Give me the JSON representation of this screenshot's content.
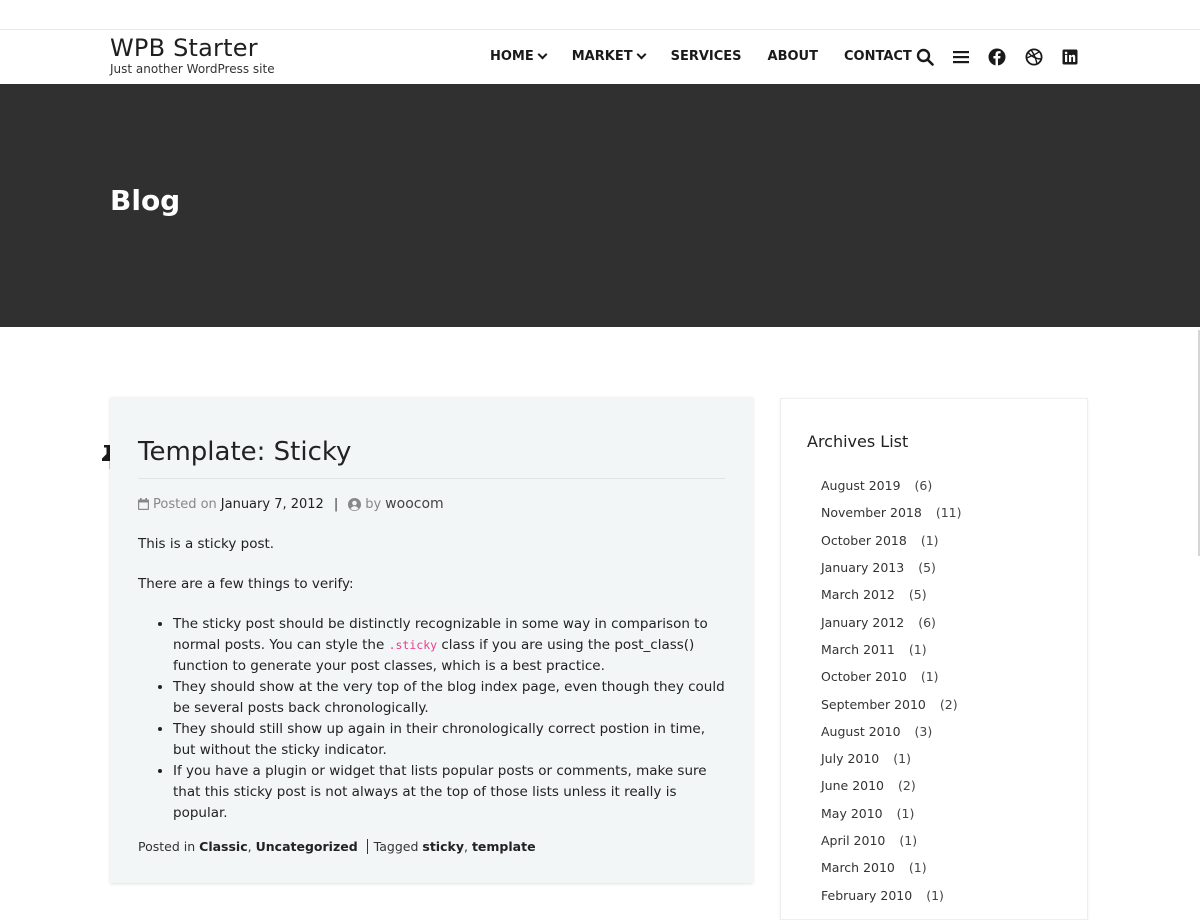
{
  "site": {
    "title": "WPB Starter",
    "tagline": "Just another WordPress site"
  },
  "nav": {
    "items": [
      {
        "label": "HOME",
        "has_dropdown": true
      },
      {
        "label": "MARKET",
        "has_dropdown": true
      },
      {
        "label": "SERVICES",
        "has_dropdown": false
      },
      {
        "label": "ABOUT",
        "has_dropdown": false
      },
      {
        "label": "CONTACT",
        "has_dropdown": false
      }
    ],
    "icons": [
      "search-icon",
      "menu-icon",
      "facebook-icon",
      "dribbble-icon",
      "linkedin-icon"
    ]
  },
  "hero": {
    "title": "Blog"
  },
  "post": {
    "title": "Template: Sticky",
    "posted_on_label": "Posted on",
    "date": "January 7, 2012",
    "separator": "|",
    "by_label": "by",
    "author": "woocom",
    "paragraphs": [
      "This is a sticky post.",
      "There are a few things to verify:"
    ],
    "bullet_1_before_code": "The sticky post should be distinctly recognizable in some way in comparison to normal posts. You can style the ",
    "bullet_1_code": ".sticky",
    "bullet_1_after_code": " class if you are using the post_class() function to generate your post classes, which is a best practice.",
    "bullets": [
      "They should show at the very top of the blog index page, even though they could be several posts back chronologically.",
      "They should still show up again in their chronologically correct postion in time, but without the sticky indicator.",
      "If you have a plugin or widget that lists popular posts or comments, make sure that this sticky post is not always at the top of those lists unless it really is popular."
    ],
    "footer": {
      "posted_in_label": "Posted in",
      "categories": [
        "Classic",
        "Uncategorized"
      ],
      "tagged_label": "Tagged",
      "tags": [
        "sticky",
        "template"
      ],
      "comma": ","
    }
  },
  "sidebar": {
    "archives_title": "Archives List",
    "archives": [
      {
        "label": "August 2019",
        "count": "(6)"
      },
      {
        "label": "November 2018",
        "count": "(11)"
      },
      {
        "label": "October 2018",
        "count": "(1)"
      },
      {
        "label": "January 2013",
        "count": "(5)"
      },
      {
        "label": "March 2012",
        "count": "(5)"
      },
      {
        "label": "January 2012",
        "count": "(6)"
      },
      {
        "label": "March 2011",
        "count": "(1)"
      },
      {
        "label": "October 2010",
        "count": "(1)"
      },
      {
        "label": "September 2010",
        "count": "(2)"
      },
      {
        "label": "August 2010",
        "count": "(3)"
      },
      {
        "label": "July 2010",
        "count": "(1)"
      },
      {
        "label": "June 2010",
        "count": "(2)"
      },
      {
        "label": "May 2010",
        "count": "(1)"
      },
      {
        "label": "April 2010",
        "count": "(1)"
      },
      {
        "label": "March 2010",
        "count": "(1)"
      },
      {
        "label": "February 2010",
        "count": "(1)"
      }
    ]
  },
  "colors": {
    "hero_bg": "#303030",
    "card_bg": "#f3f6f6",
    "code_pink": "#e83e8c"
  }
}
